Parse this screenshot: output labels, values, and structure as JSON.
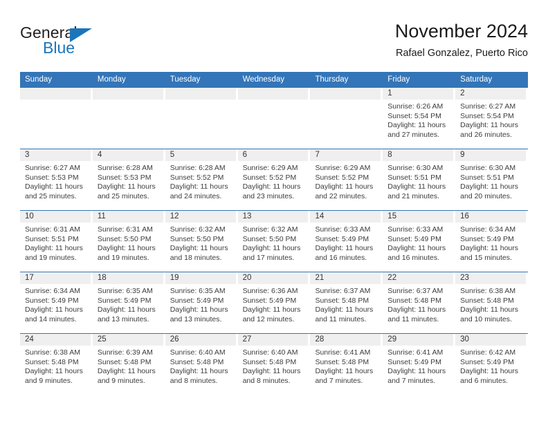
{
  "brand": {
    "name_part1": "General",
    "name_part2": "Blue",
    "accent_color": "#1b75bb"
  },
  "header": {
    "title": "November 2024",
    "subtitle": "Rafael Gonzalez, Puerto Rico"
  },
  "theme": {
    "header_blue": "#3375b8",
    "day_strip_gray": "#efefef"
  },
  "weekdays": [
    "Sunday",
    "Monday",
    "Tuesday",
    "Wednesday",
    "Thursday",
    "Friday",
    "Saturday"
  ],
  "weeks": [
    [
      {
        "day": "",
        "sunrise": "",
        "sunset": "",
        "daylight": ""
      },
      {
        "day": "",
        "sunrise": "",
        "sunset": "",
        "daylight": ""
      },
      {
        "day": "",
        "sunrise": "",
        "sunset": "",
        "daylight": ""
      },
      {
        "day": "",
        "sunrise": "",
        "sunset": "",
        "daylight": ""
      },
      {
        "day": "",
        "sunrise": "",
        "sunset": "",
        "daylight": ""
      },
      {
        "day": "1",
        "sunrise": "Sunrise: 6:26 AM",
        "sunset": "Sunset: 5:54 PM",
        "daylight": "Daylight: 11 hours and 27 minutes."
      },
      {
        "day": "2",
        "sunrise": "Sunrise: 6:27 AM",
        "sunset": "Sunset: 5:54 PM",
        "daylight": "Daylight: 11 hours and 26 minutes."
      }
    ],
    [
      {
        "day": "3",
        "sunrise": "Sunrise: 6:27 AM",
        "sunset": "Sunset: 5:53 PM",
        "daylight": "Daylight: 11 hours and 25 minutes."
      },
      {
        "day": "4",
        "sunrise": "Sunrise: 6:28 AM",
        "sunset": "Sunset: 5:53 PM",
        "daylight": "Daylight: 11 hours and 25 minutes."
      },
      {
        "day": "5",
        "sunrise": "Sunrise: 6:28 AM",
        "sunset": "Sunset: 5:52 PM",
        "daylight": "Daylight: 11 hours and 24 minutes."
      },
      {
        "day": "6",
        "sunrise": "Sunrise: 6:29 AM",
        "sunset": "Sunset: 5:52 PM",
        "daylight": "Daylight: 11 hours and 23 minutes."
      },
      {
        "day": "7",
        "sunrise": "Sunrise: 6:29 AM",
        "sunset": "Sunset: 5:52 PM",
        "daylight": "Daylight: 11 hours and 22 minutes."
      },
      {
        "day": "8",
        "sunrise": "Sunrise: 6:30 AM",
        "sunset": "Sunset: 5:51 PM",
        "daylight": "Daylight: 11 hours and 21 minutes."
      },
      {
        "day": "9",
        "sunrise": "Sunrise: 6:30 AM",
        "sunset": "Sunset: 5:51 PM",
        "daylight": "Daylight: 11 hours and 20 minutes."
      }
    ],
    [
      {
        "day": "10",
        "sunrise": "Sunrise: 6:31 AM",
        "sunset": "Sunset: 5:51 PM",
        "daylight": "Daylight: 11 hours and 19 minutes."
      },
      {
        "day": "11",
        "sunrise": "Sunrise: 6:31 AM",
        "sunset": "Sunset: 5:50 PM",
        "daylight": "Daylight: 11 hours and 19 minutes."
      },
      {
        "day": "12",
        "sunrise": "Sunrise: 6:32 AM",
        "sunset": "Sunset: 5:50 PM",
        "daylight": "Daylight: 11 hours and 18 minutes."
      },
      {
        "day": "13",
        "sunrise": "Sunrise: 6:32 AM",
        "sunset": "Sunset: 5:50 PM",
        "daylight": "Daylight: 11 hours and 17 minutes."
      },
      {
        "day": "14",
        "sunrise": "Sunrise: 6:33 AM",
        "sunset": "Sunset: 5:49 PM",
        "daylight": "Daylight: 11 hours and 16 minutes."
      },
      {
        "day": "15",
        "sunrise": "Sunrise: 6:33 AM",
        "sunset": "Sunset: 5:49 PM",
        "daylight": "Daylight: 11 hours and 16 minutes."
      },
      {
        "day": "16",
        "sunrise": "Sunrise: 6:34 AM",
        "sunset": "Sunset: 5:49 PM",
        "daylight": "Daylight: 11 hours and 15 minutes."
      }
    ],
    [
      {
        "day": "17",
        "sunrise": "Sunrise: 6:34 AM",
        "sunset": "Sunset: 5:49 PM",
        "daylight": "Daylight: 11 hours and 14 minutes."
      },
      {
        "day": "18",
        "sunrise": "Sunrise: 6:35 AM",
        "sunset": "Sunset: 5:49 PM",
        "daylight": "Daylight: 11 hours and 13 minutes."
      },
      {
        "day": "19",
        "sunrise": "Sunrise: 6:35 AM",
        "sunset": "Sunset: 5:49 PM",
        "daylight": "Daylight: 11 hours and 13 minutes."
      },
      {
        "day": "20",
        "sunrise": "Sunrise: 6:36 AM",
        "sunset": "Sunset: 5:49 PM",
        "daylight": "Daylight: 11 hours and 12 minutes."
      },
      {
        "day": "21",
        "sunrise": "Sunrise: 6:37 AM",
        "sunset": "Sunset: 5:48 PM",
        "daylight": "Daylight: 11 hours and 11 minutes."
      },
      {
        "day": "22",
        "sunrise": "Sunrise: 6:37 AM",
        "sunset": "Sunset: 5:48 PM",
        "daylight": "Daylight: 11 hours and 11 minutes."
      },
      {
        "day": "23",
        "sunrise": "Sunrise: 6:38 AM",
        "sunset": "Sunset: 5:48 PM",
        "daylight": "Daylight: 11 hours and 10 minutes."
      }
    ],
    [
      {
        "day": "24",
        "sunrise": "Sunrise: 6:38 AM",
        "sunset": "Sunset: 5:48 PM",
        "daylight": "Daylight: 11 hours and 9 minutes."
      },
      {
        "day": "25",
        "sunrise": "Sunrise: 6:39 AM",
        "sunset": "Sunset: 5:48 PM",
        "daylight": "Daylight: 11 hours and 9 minutes."
      },
      {
        "day": "26",
        "sunrise": "Sunrise: 6:40 AM",
        "sunset": "Sunset: 5:48 PM",
        "daylight": "Daylight: 11 hours and 8 minutes."
      },
      {
        "day": "27",
        "sunrise": "Sunrise: 6:40 AM",
        "sunset": "Sunset: 5:48 PM",
        "daylight": "Daylight: 11 hours and 8 minutes."
      },
      {
        "day": "28",
        "sunrise": "Sunrise: 6:41 AM",
        "sunset": "Sunset: 5:48 PM",
        "daylight": "Daylight: 11 hours and 7 minutes."
      },
      {
        "day": "29",
        "sunrise": "Sunrise: 6:41 AM",
        "sunset": "Sunset: 5:49 PM",
        "daylight": "Daylight: 11 hours and 7 minutes."
      },
      {
        "day": "30",
        "sunrise": "Sunrise: 6:42 AM",
        "sunset": "Sunset: 5:49 PM",
        "daylight": "Daylight: 11 hours and 6 minutes."
      }
    ]
  ]
}
